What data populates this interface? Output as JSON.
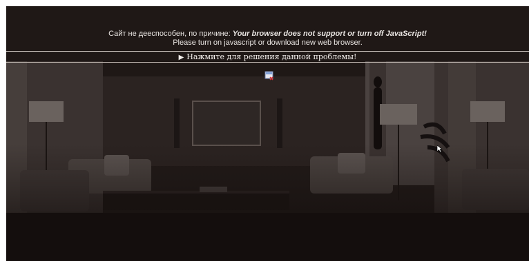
{
  "notice": {
    "line1_prefix": "Сайт не дееспособен, по причине:",
    "line1_reason": "Your browser does not support or turn off JavaScript!",
    "line2": "Please turn on javascript or download new web browser.",
    "help_link": "Нажмите для решения данной проблемы!",
    "help_icon": "play-triangle-icon"
  },
  "colors": {
    "room_dark": "#1a1412",
    "room_mid": "#3b322f",
    "text": "#e9e5e2"
  },
  "icons": {
    "broken_image": "broken-image-icon",
    "cursor": "mouse-cursor-icon"
  }
}
